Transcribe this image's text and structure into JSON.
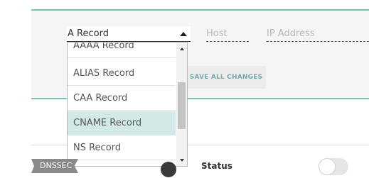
{
  "record_form": {
    "type_select_value": "A Record",
    "host_placeholder": "Host",
    "ip_placeholder": "IP Address"
  },
  "save_button_label": "SAVE ALL CHANGES",
  "type_dropdown": {
    "options": [
      "AAAA Record",
      "ALIAS Record",
      "CAA Record",
      "CNAME Record",
      "NS Record"
    ],
    "highlighted": "CNAME Record"
  },
  "dnssec": {
    "tag_label": "DNSSEC",
    "status_label": "Status",
    "toggle_on": false
  },
  "colors": {
    "accent_line": "#7fbfbb",
    "highlight": "#d3e9e8",
    "button_text": "#7aa9a6"
  }
}
